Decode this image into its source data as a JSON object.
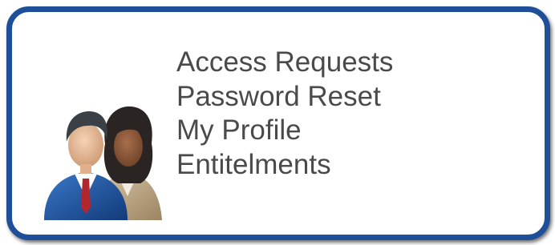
{
  "menu": {
    "items": [
      {
        "label": "Access Requests"
      },
      {
        "label": "Password Reset"
      },
      {
        "label": "My Profile"
      },
      {
        "label": "Entitelments"
      }
    ]
  },
  "icon": {
    "name": "users-icon"
  },
  "colors": {
    "border": "#1f4f98",
    "text": "#4a4a4a",
    "background": "#ffffff"
  }
}
